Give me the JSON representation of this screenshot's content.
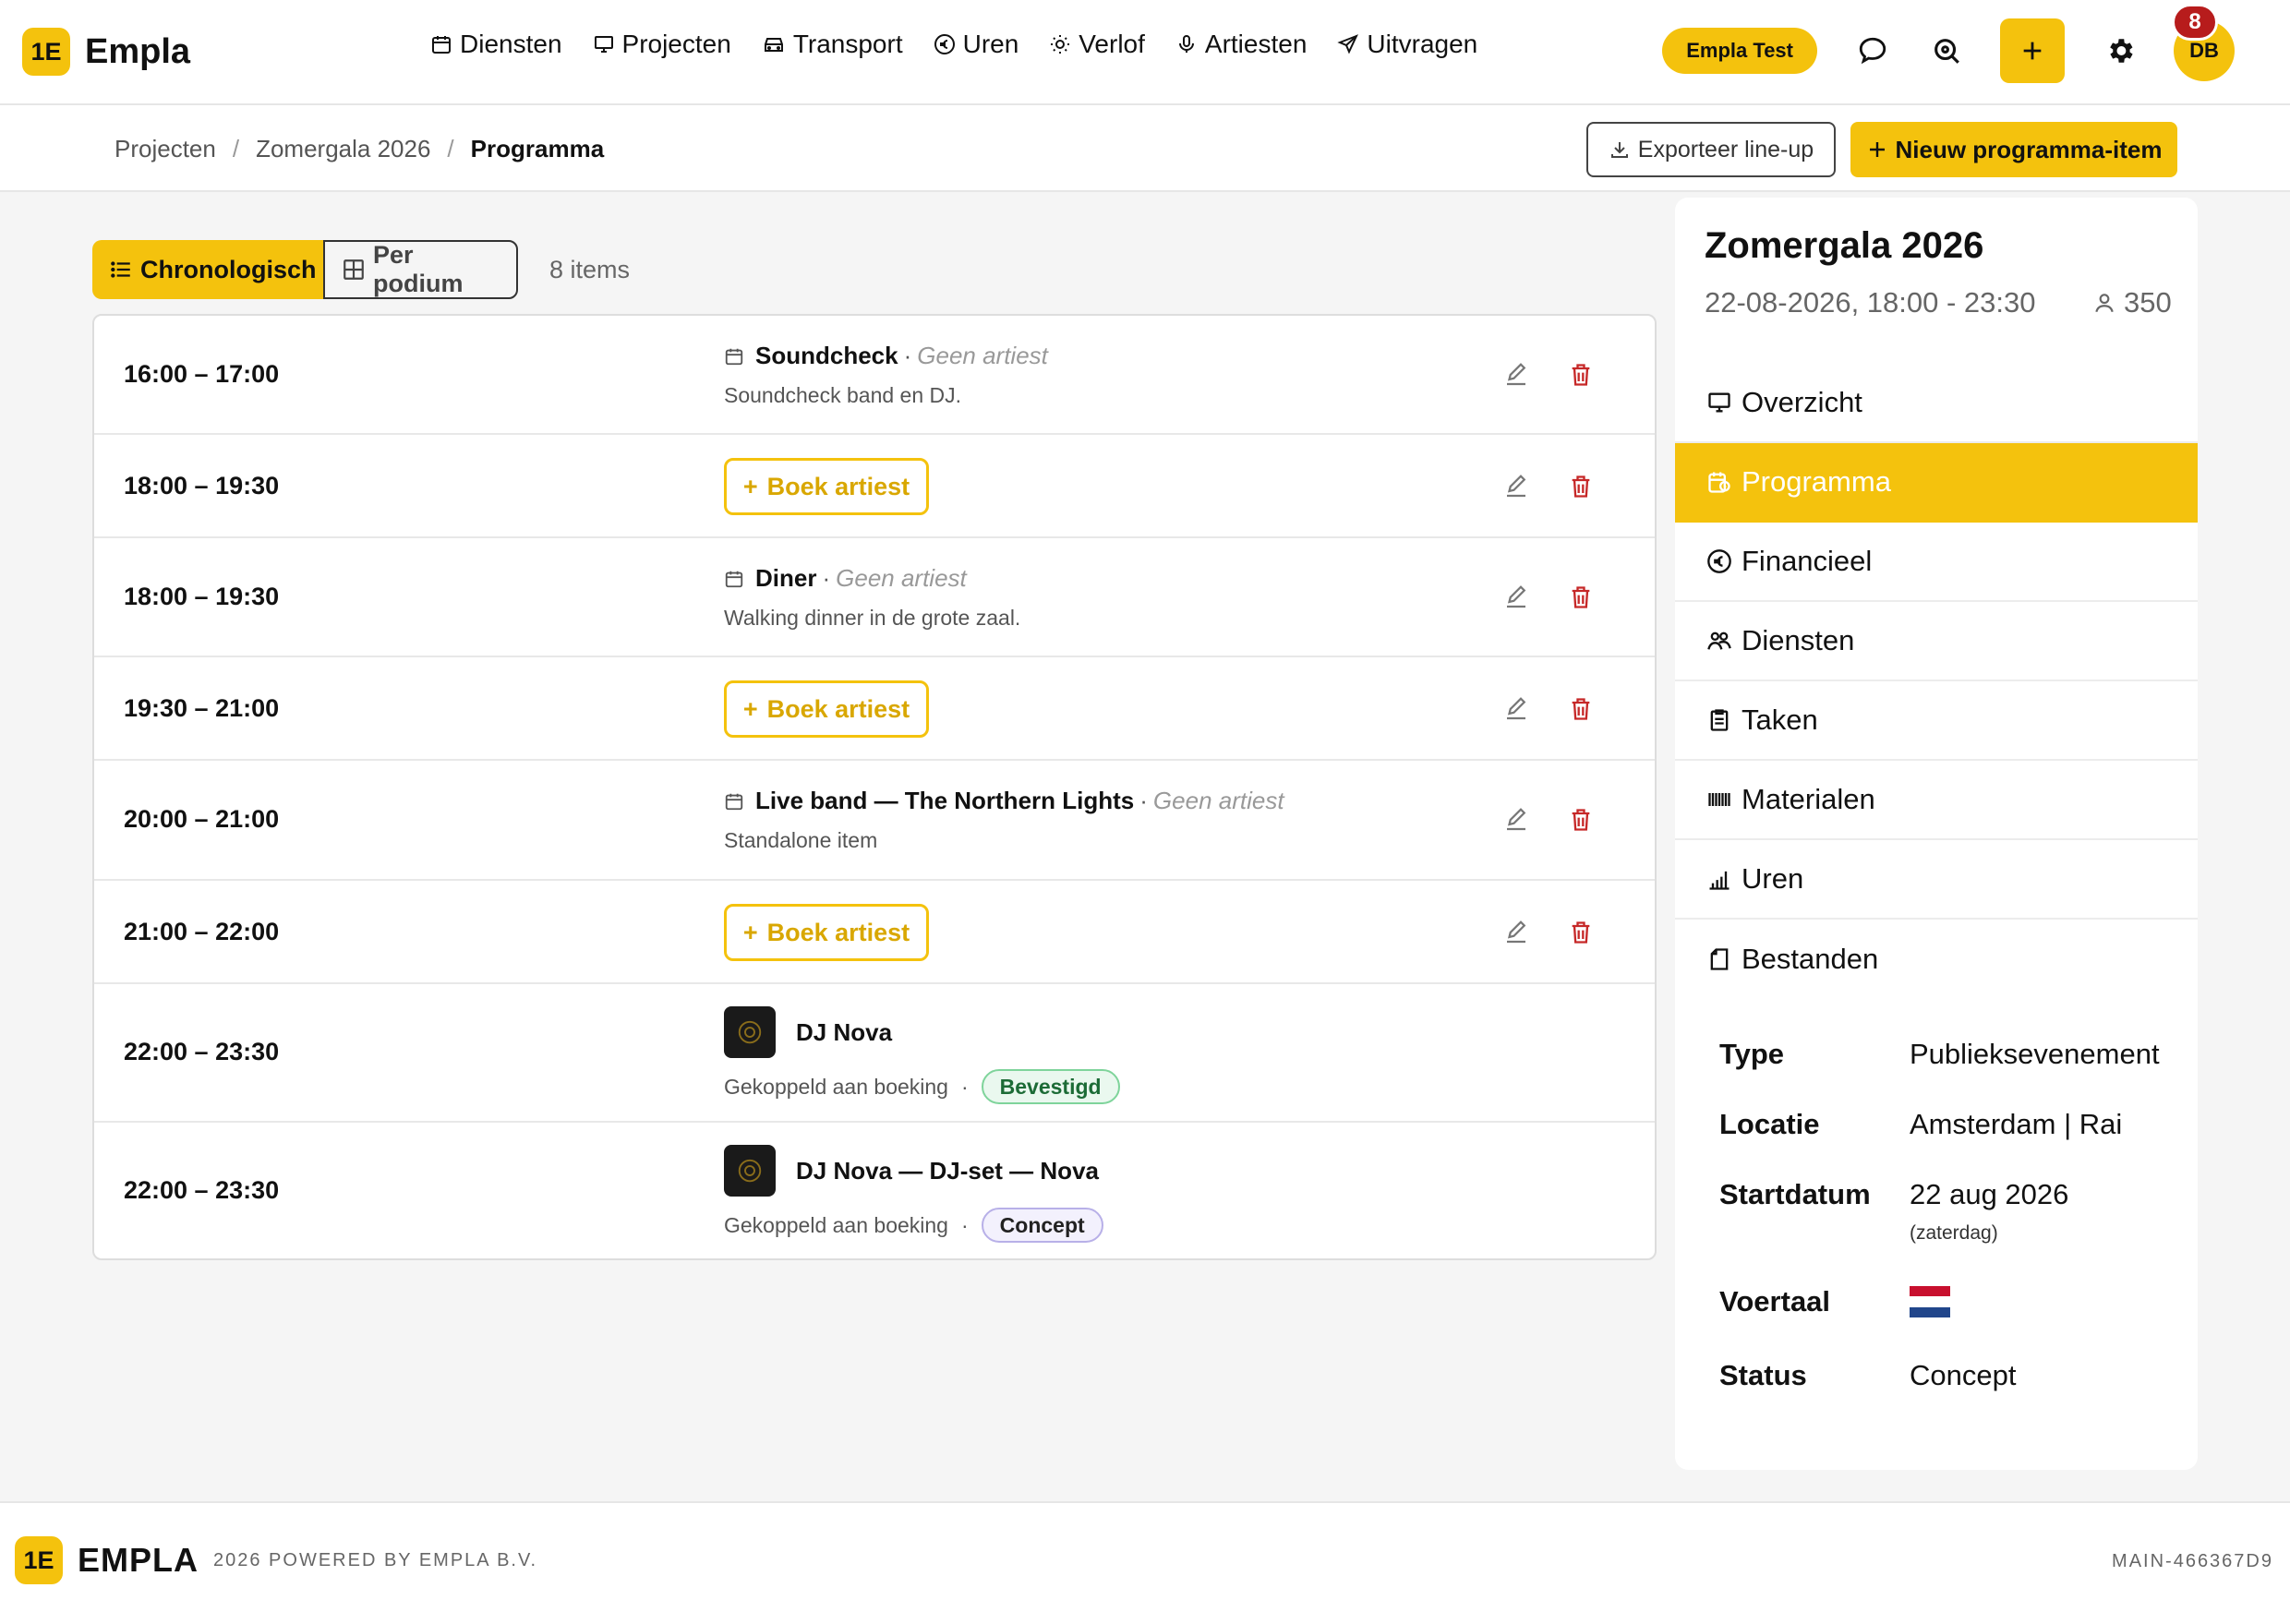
{
  "app": {
    "logo_mark": "1E",
    "name": "Empla"
  },
  "nav": {
    "items": [
      {
        "label": "Diensten",
        "icon": "calendar-icon"
      },
      {
        "label": "Projecten",
        "icon": "monitor-icon"
      },
      {
        "label": "Transport",
        "icon": "car-icon"
      },
      {
        "label": "Uren",
        "icon": "euro-icon"
      },
      {
        "label": "Verlof",
        "icon": "sun-icon"
      },
      {
        "label": "Artiesten",
        "icon": "microphone-icon"
      },
      {
        "label": "Uitvragen",
        "icon": "send-icon"
      }
    ],
    "env_badge": "Empla Test",
    "notification_count": "8",
    "avatar_initials": "DB"
  },
  "breadcrumb": {
    "items": [
      "Projecten",
      "Zomergala 2026"
    ],
    "current": "Programma",
    "separator": "/"
  },
  "actions": {
    "export_label": "Exporteer line-up",
    "new_label": "Nieuw programma-item"
  },
  "view": {
    "chronological_label": "Chronologisch",
    "per_stage_label": "Per podium",
    "count_label": "8 items"
  },
  "program": {
    "no_artist_label": "Geen artiest",
    "book_artist_label": "Boek artiest",
    "linked_label": "Gekoppeld aan boeking",
    "items": [
      {
        "time": "16:00 – 17:00",
        "title": "Soundcheck",
        "desc": "Soundcheck band en DJ."
      },
      {
        "time": "18:00 – 19:30"
      },
      {
        "time": "18:00 – 19:30",
        "title": "Diner",
        "desc": "Walking dinner in de grote zaal."
      },
      {
        "time": "19:30 – 21:00"
      },
      {
        "time": "20:00 – 21:00",
        "title": "Live band — The Northern Lights",
        "desc": "Standalone item"
      },
      {
        "time": "21:00 – 22:00"
      },
      {
        "time": "22:00 – 23:30",
        "artist": "DJ Nova",
        "status": "Bevestigd"
      },
      {
        "time": "22:00 – 23:30",
        "artist": "DJ Nova — DJ-set — Nova",
        "status": "Concept"
      }
    ]
  },
  "side": {
    "title": "Zomergala 2026",
    "datetime": "22-08-2026, 18:00 - 23:30",
    "capacity": "350",
    "menu": [
      {
        "label": "Overzicht",
        "icon": "monitor-icon"
      },
      {
        "label": "Programma",
        "icon": "calendar-clock-icon"
      },
      {
        "label": "Financieel",
        "icon": "euro-icon"
      },
      {
        "label": "Diensten",
        "icon": "people-icon"
      },
      {
        "label": "Taken",
        "icon": "clipboard-icon"
      },
      {
        "label": "Materialen",
        "icon": "barcode-icon"
      },
      {
        "label": "Uren",
        "icon": "bar-chart-icon"
      },
      {
        "label": "Bestanden",
        "icon": "file-icon"
      }
    ],
    "details": {
      "type_key": "Type",
      "type_val": "Publieksevenement",
      "location_key": "Locatie",
      "location_val": "Amsterdam | Rai",
      "start_key": "Startdatum",
      "start_val": "22 aug 2026",
      "start_sub": "(zaterdag)",
      "lang_key": "Voertaal",
      "lang_flag": "dutch-flag-icon",
      "status_key": "Status",
      "status_val": "Concept"
    }
  },
  "footer": {
    "logo_mark": "1E",
    "brand": "EMPLA",
    "powered": "2026 POWERED BY EMPLA B.V.",
    "build": "MAIN-466367D9"
  },
  "colors": {
    "accent": "#f4c20d",
    "danger": "#c62828",
    "confirmed": "#1c6b36",
    "notification": "#b71c1c"
  }
}
